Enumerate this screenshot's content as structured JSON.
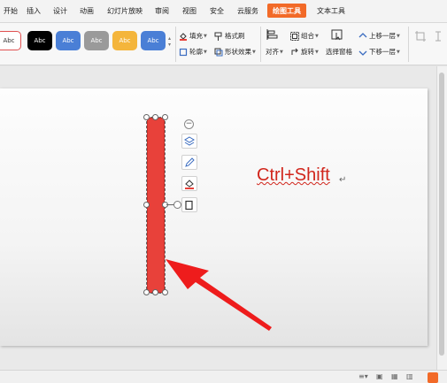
{
  "tabs": [
    {
      "label": "开始",
      "active": false
    },
    {
      "label": "插入",
      "active": false
    },
    {
      "label": "设计",
      "active": false
    },
    {
      "label": "动画",
      "active": false
    },
    {
      "label": "幻灯片放映",
      "active": false
    },
    {
      "label": "审阅",
      "active": false
    },
    {
      "label": "视图",
      "active": false
    },
    {
      "label": "安全",
      "active": false
    },
    {
      "label": "云服务",
      "active": false
    },
    {
      "label": "绘图工具",
      "active": true
    },
    {
      "label": "文本工具",
      "active": false
    }
  ],
  "style_swatches": [
    {
      "label": "Abc",
      "bg": "#ffffff",
      "fg": "#333333",
      "border": "#e05050"
    },
    {
      "label": "Abc",
      "bg": "#000000",
      "fg": "#ffffff",
      "border": "#000000"
    },
    {
      "label": "Abc",
      "bg": "#4a7fd6",
      "fg": "#ffffff",
      "border": "#3a6cc0"
    },
    {
      "label": "Abc",
      "bg": "#9a9a9a",
      "fg": "#ffffff",
      "border": "#888888"
    },
    {
      "label": "Abc",
      "bg": "#f4b53b",
      "fg": "#ffffff",
      "border": "#dca030"
    },
    {
      "label": "Abc",
      "bg": "#4a7fd6",
      "fg": "#ffffff",
      "border": "#3a6cc0"
    }
  ],
  "ribbon": {
    "fill": "填充",
    "outline": "轮廓",
    "format_painter": "格式刷",
    "shape_effects": "形状效果",
    "align": "对齐",
    "group": "组合",
    "rotate": "旋转",
    "selection_pane": "选择窗格",
    "bring_forward": "上移一层",
    "send_backward": "下移一层"
  },
  "slide": {
    "text": "Ctrl+Shift",
    "paragraph_mark": "↵"
  },
  "colors": {
    "accent_tab": "#f26a28",
    "shape_fill": "#e8413a",
    "arrow": "#ee1c1c",
    "text_red": "#d1261c"
  }
}
